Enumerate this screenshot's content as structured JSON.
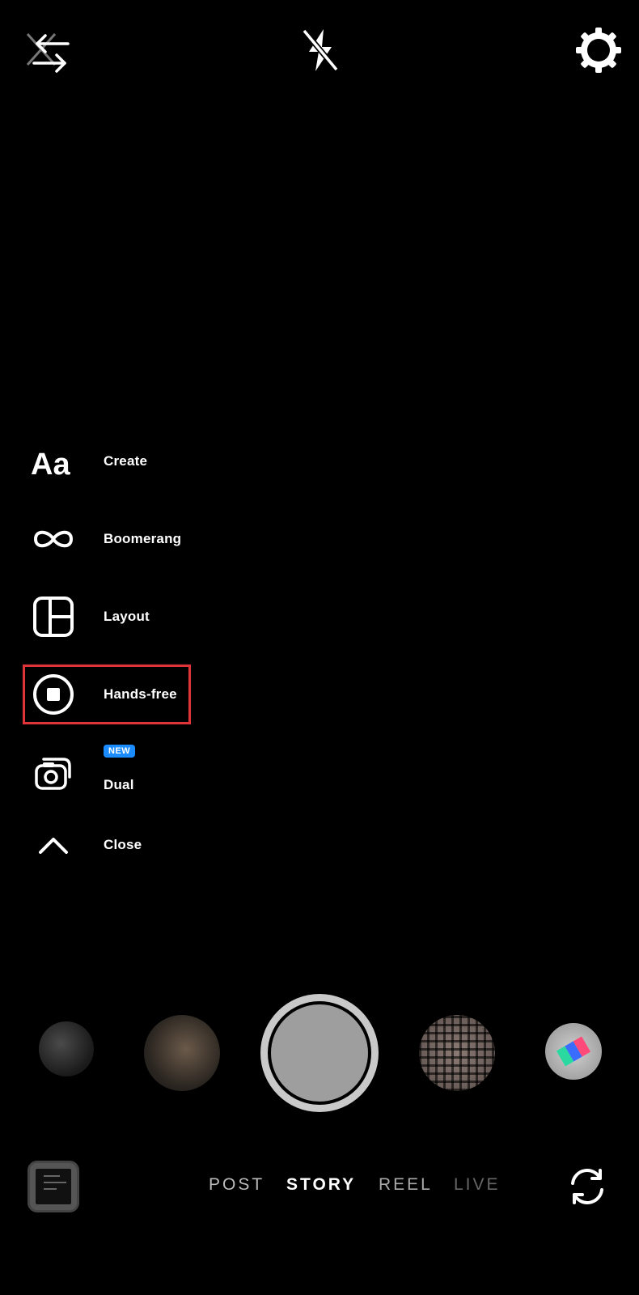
{
  "top_bar": {
    "left_icon": "swap-arrows-icon",
    "center_icon": "flash-off-icon",
    "right_icon": "gear-icon"
  },
  "menu": {
    "items": [
      {
        "label": "Create",
        "icon": "text-aa-icon"
      },
      {
        "label": "Boomerang",
        "icon": "infinity-icon"
      },
      {
        "label": "Layout",
        "icon": "layout-grid-icon"
      },
      {
        "label": "Hands-free",
        "icon": "record-stop-icon"
      },
      {
        "label": "Dual",
        "icon": "dual-camera-icon",
        "badge": "NEW"
      },
      {
        "label": "Close",
        "icon": "chevron-up-icon"
      }
    ],
    "highlighted_item": "Hands-free"
  },
  "capture": {
    "shutter": "shutter-button"
  },
  "modes": [
    "POST",
    "STORY",
    "REEL",
    "LIVE"
  ],
  "selected_mode": "STORY",
  "bottom": {
    "left_icon": "gallery-thumbnail",
    "right_icon": "flip-camera-icon"
  },
  "colors": {
    "background": "#000000",
    "highlight_border": "#e0343a",
    "new_badge": "#1a8cff"
  }
}
